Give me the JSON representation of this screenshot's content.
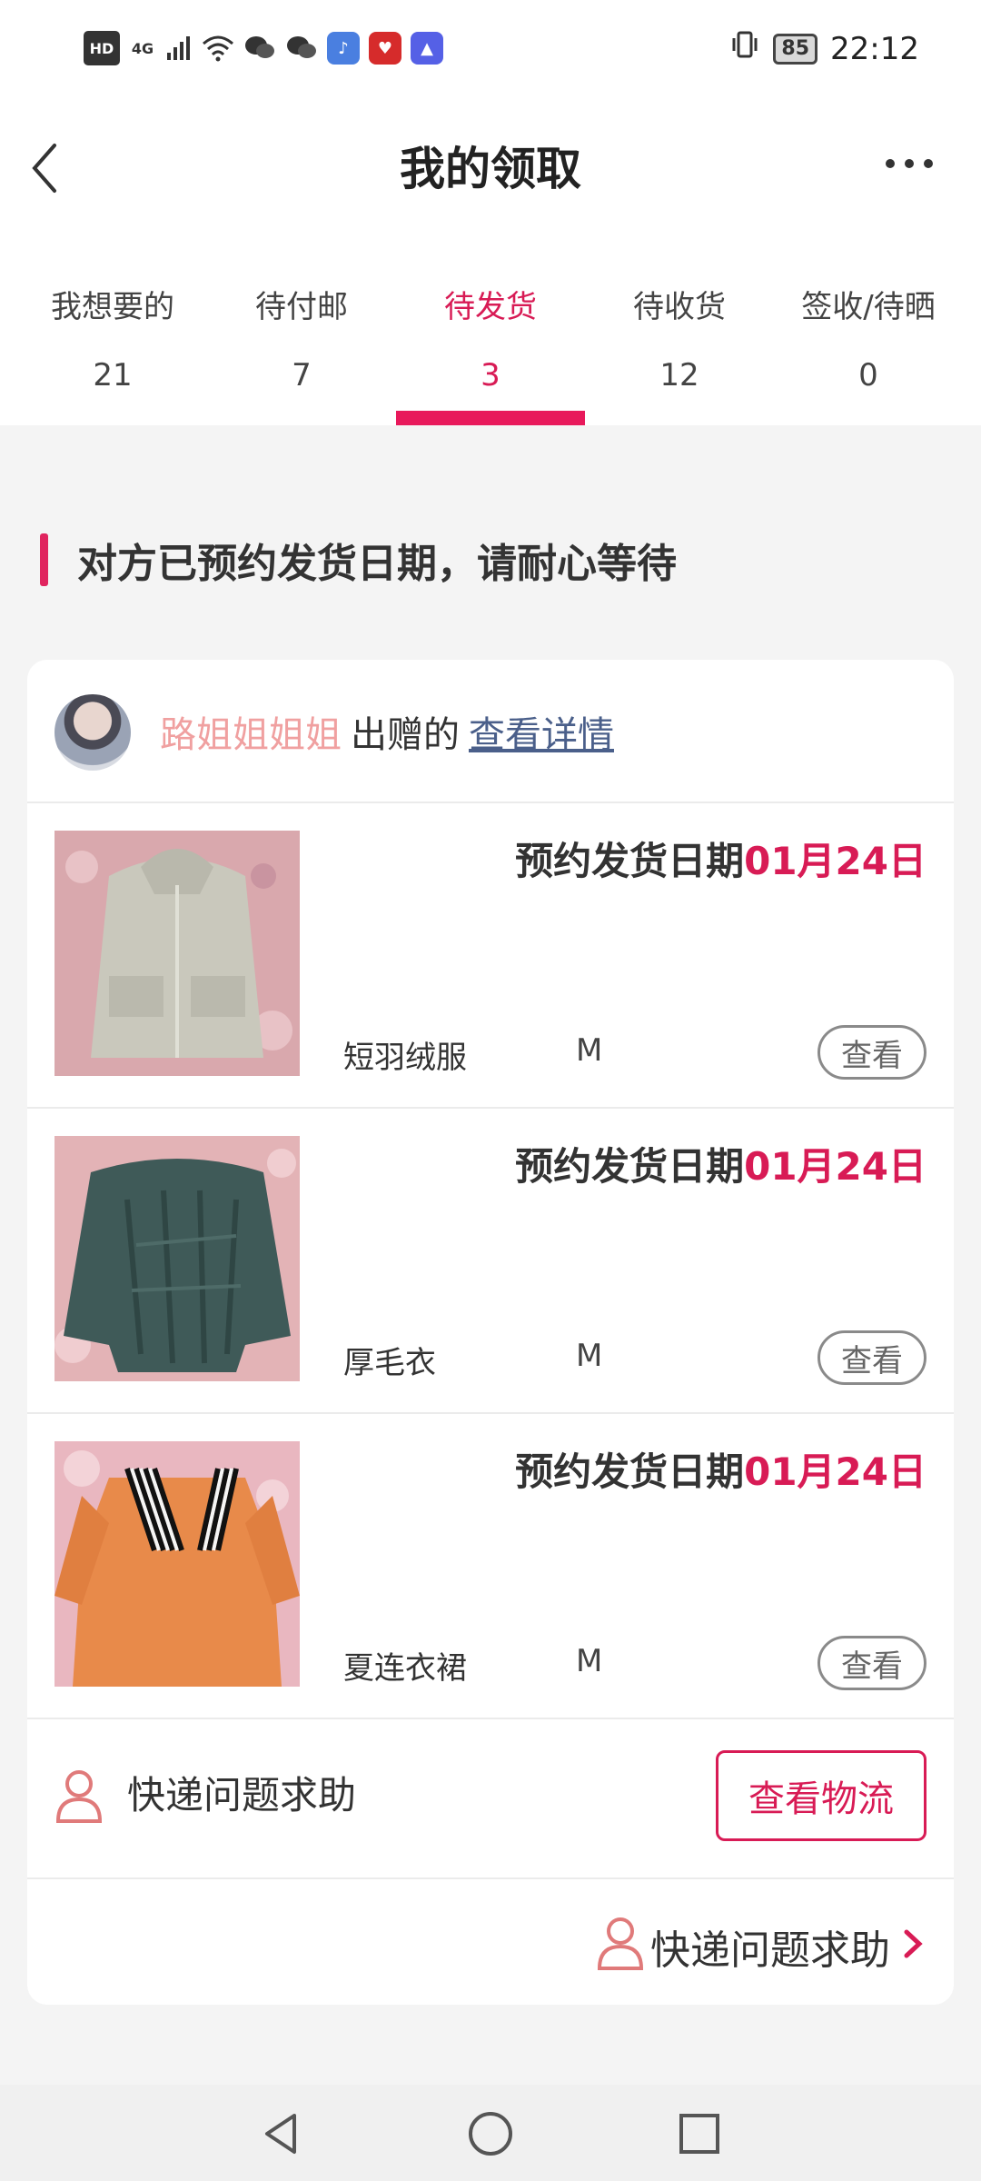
{
  "status_bar": {
    "indicators": [
      "HD",
      "4G"
    ],
    "battery": "85",
    "time": "22:12",
    "icons": [
      "signal-icon",
      "wifi-icon",
      "wechat-icon",
      "wechat-icon",
      "music-app-icon",
      "red-app-icon",
      "education-app-icon",
      "vibrate-icon"
    ]
  },
  "header": {
    "title": "我的领取",
    "back_icon": "chevron-left-icon",
    "more_icon": "more-dots-icon"
  },
  "tabs": [
    {
      "label": "我想要的",
      "count": "21"
    },
    {
      "label": "待付邮",
      "count": "7"
    },
    {
      "label": "待发货",
      "count": "3",
      "active": true
    },
    {
      "label": "待收货",
      "count": "12"
    },
    {
      "label": "签收/待晒",
      "count": "0"
    }
  ],
  "notice": "对方已预约发货日期，请耐心等待",
  "giver": {
    "name": "路姐姐姐姐",
    "suffix": "出赠的",
    "details_link": "查看详情"
  },
  "items": [
    {
      "date_label": "预约发货日期",
      "date_value": "01月24日",
      "name": "短羽绒服",
      "size": "M",
      "view_label": "查看"
    },
    {
      "date_label": "预约发货日期",
      "date_value": "01月24日",
      "name": "厚毛衣",
      "size": "M",
      "view_label": "查看"
    },
    {
      "date_label": "预约发货日期",
      "date_value": "01月24日",
      "name": "夏连衣裙",
      "size": "M",
      "view_label": "查看"
    }
  ],
  "help": {
    "label": "快递问题求助",
    "logistics_button": "查看物流",
    "label2": "快递问题求助"
  },
  "colors": {
    "accent": "#d81b55",
    "giver_name": "#f0a0a0",
    "link": "#4a5f8a"
  }
}
